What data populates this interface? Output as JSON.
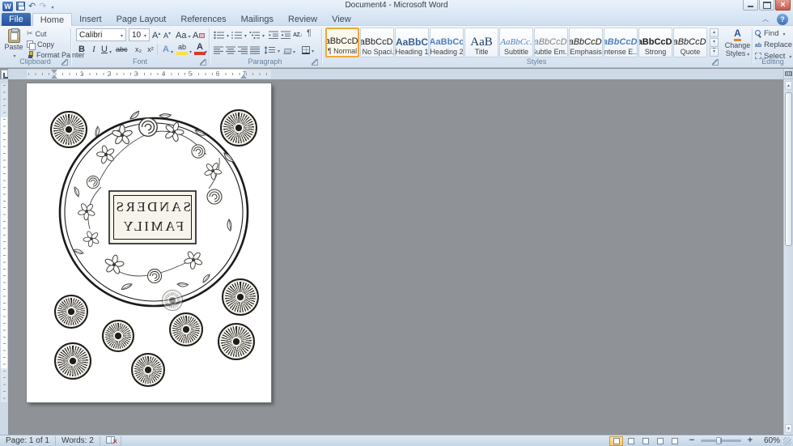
{
  "window": {
    "title": "Document4 - Microsoft Word"
  },
  "tabs": {
    "file": "File",
    "home": "Home",
    "insert": "Insert",
    "page_layout": "Page Layout",
    "references": "References",
    "mailings": "Mailings",
    "review": "Review",
    "view": "View"
  },
  "clipboard": {
    "title": "Clipboard",
    "paste": "Paste",
    "cut": "Cut",
    "copy": "Copy",
    "format_painter": "Format Painter"
  },
  "font": {
    "title": "Font",
    "family": "Calibri",
    "size": "10",
    "bold": "B",
    "italic": "I",
    "underline": "U",
    "strike": "abc",
    "subscript": "x₂",
    "superscript": "x²",
    "grow": "A",
    "shrink": "A",
    "change_case": "Aa",
    "clear": "A",
    "effects": "A",
    "highlight": "ab",
    "color": "A"
  },
  "paragraph": {
    "title": "Paragraph"
  },
  "styles": {
    "title": "Styles",
    "change1": "Change",
    "change2": "Styles",
    "items": [
      {
        "sample": "AaBbCcDdI",
        "label": "¶ Normal"
      },
      {
        "sample": "AaBbCcDdI",
        "label": "¶ No Spaci..."
      },
      {
        "sample": "AaBbC",
        "label": "Heading 1"
      },
      {
        "sample": "AaBbCc",
        "label": "Heading 2"
      },
      {
        "sample": "AaB",
        "label": "Title"
      },
      {
        "sample": "AaBbCc.",
        "label": "Subtitle"
      },
      {
        "sample": "AaBbCcDdI",
        "label": "Subtle Em..."
      },
      {
        "sample": "AaBbCcDdI",
        "label": "Emphasis"
      },
      {
        "sample": "AaBbCcDdI",
        "label": "Intense E..."
      },
      {
        "sample": "AaBbCcDdI",
        "label": "Strong"
      },
      {
        "sample": "AaBbCcDdI",
        "label": "Quote"
      }
    ]
  },
  "editing": {
    "title": "Editing",
    "find": "Find",
    "replace": "Replace",
    "select": "Select"
  },
  "ruler": {
    "numbers": [
      "1",
      "2",
      "3",
      "4",
      "5",
      "6",
      "7"
    ]
  },
  "doc": {
    "line1": "SANDERS",
    "line2": "FAMILY"
  },
  "status": {
    "page": "Page: 1 of 1",
    "words": "Words: 2",
    "zoom": "60%"
  }
}
